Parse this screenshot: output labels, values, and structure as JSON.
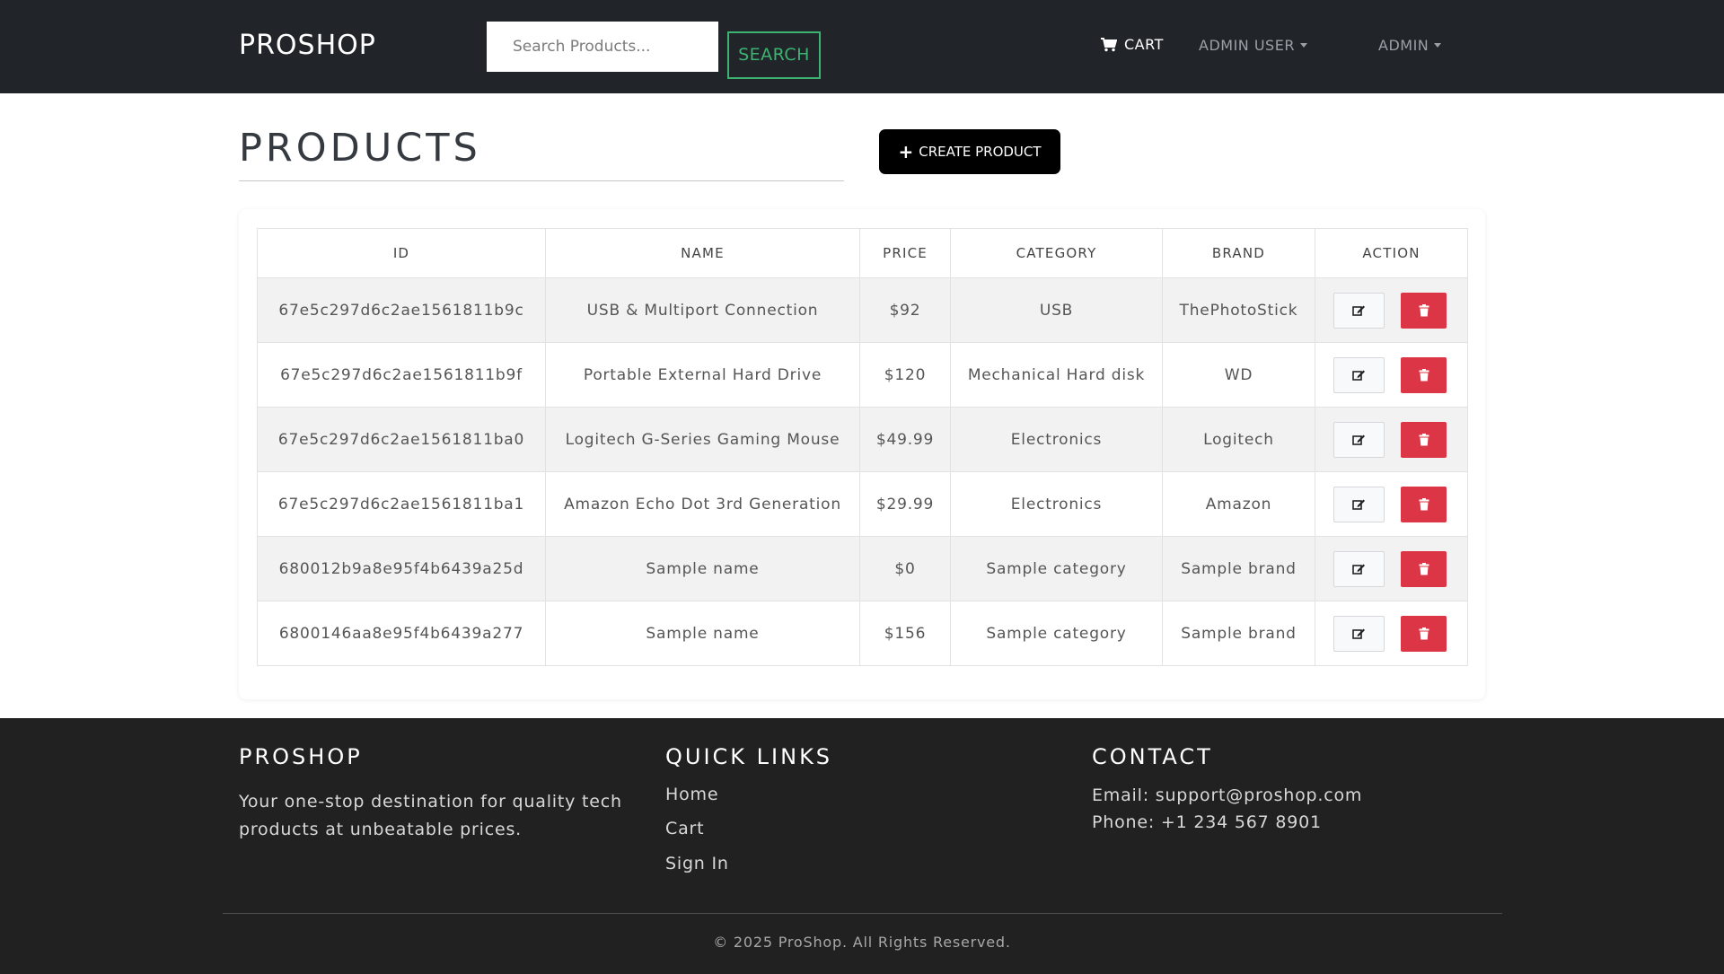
{
  "navbar": {
    "brand": "PROSHOP",
    "search_placeholder": "Search Products...",
    "search_label": "SEARCH",
    "cart_label": "CART",
    "user_menu_label": "ADMIN USER",
    "admin_menu_label": "ADMIN"
  },
  "page": {
    "title": "PRODUCTS",
    "create_label": "CREATE PRODUCT"
  },
  "table": {
    "headers": [
      "ID",
      "NAME",
      "PRICE",
      "CATEGORY",
      "BRAND",
      "ACTION"
    ],
    "rows": [
      {
        "id": "67e5c297d6c2ae1561811b9c",
        "name": "USB & Multiport Connection",
        "price": "$92",
        "category": "USB",
        "brand": "ThePhotoStick"
      },
      {
        "id": "67e5c297d6c2ae1561811b9f",
        "name": "Portable External Hard Drive",
        "price": "$120",
        "category": "Mechanical Hard disk",
        "brand": "WD"
      },
      {
        "id": "67e5c297d6c2ae1561811ba0",
        "name": "Logitech G-Series Gaming Mouse",
        "price": "$49.99",
        "category": "Electronics",
        "brand": "Logitech"
      },
      {
        "id": "67e5c297d6c2ae1561811ba1",
        "name": "Amazon Echo Dot 3rd Generation",
        "price": "$29.99",
        "category": "Electronics",
        "brand": "Amazon"
      },
      {
        "id": "680012b9a8e95f4b6439a25d",
        "name": "Sample name",
        "price": "$0",
        "category": "Sample category",
        "brand": "Sample brand"
      },
      {
        "id": "6800146aa8e95f4b6439a277",
        "name": "Sample name",
        "price": "$156",
        "category": "Sample category",
        "brand": "Sample brand"
      }
    ],
    "edit_icon": "edit-icon",
    "delete_icon": "trash-icon"
  },
  "footer": {
    "about_title": "PROSHOP",
    "about_text_1": "Your one-stop destination for quality tech",
    "about_text_2": "products at unbeatable prices.",
    "links_title": "QUICK LINKS",
    "links": [
      "Home",
      "Cart",
      "Sign In"
    ],
    "contact_title": "CONTACT",
    "email": "Email: support@proshop.com",
    "phone": "Phone: +1 234 567 8901",
    "copyright": "© 2025 ProShop. All Rights Reserved."
  },
  "colors": {
    "navbar_bg": "#212529",
    "footer_bg": "#212121",
    "search_accent": "#3cb371",
    "delete_red": "#dc3545",
    "create_bg": "#000000",
    "striped_row": "#f2f2f2"
  }
}
